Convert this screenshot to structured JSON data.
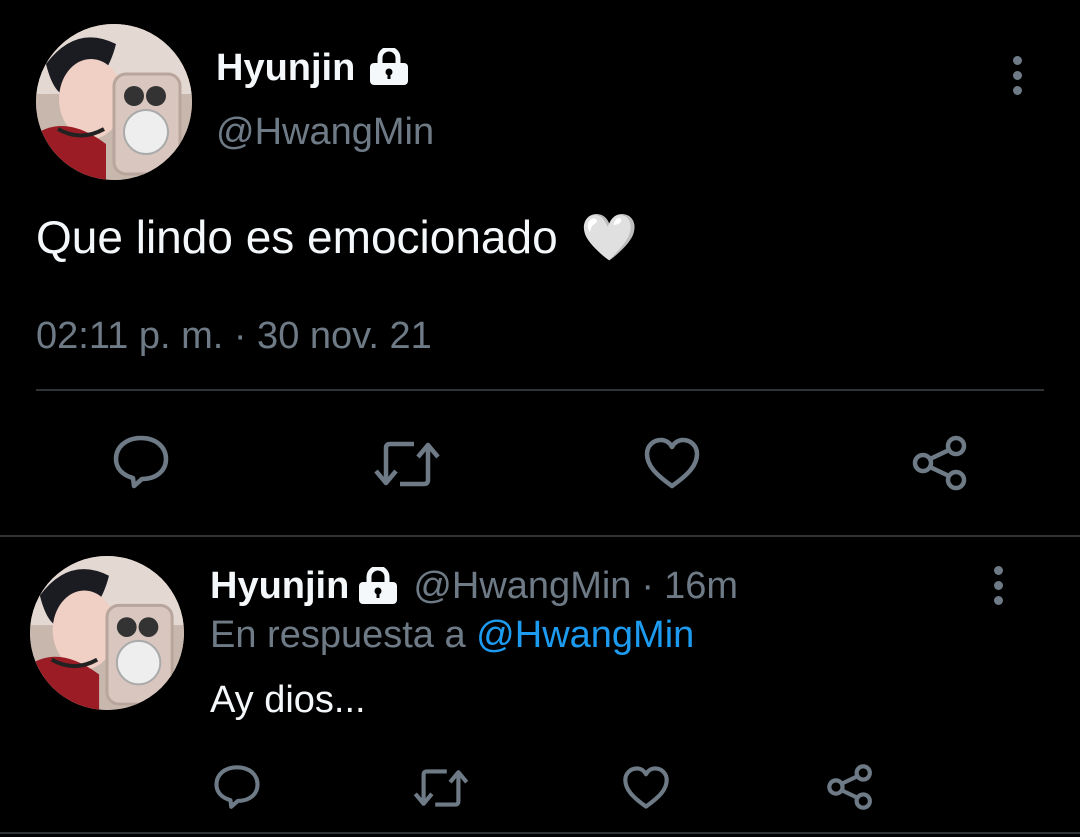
{
  "main_tweet": {
    "author_name": "Hyunjin",
    "author_handle": "@HwangMin",
    "text": "Que lindo es emocionado",
    "emoji": "🤍",
    "timestamp": "02:11 p. m. · 30 nov. 21",
    "icons": [
      "lock-icon",
      "more-options-icon",
      "reply-icon",
      "retweet-icon",
      "like-icon",
      "share-icon"
    ]
  },
  "reply_tweet": {
    "author_name": "Hyunjin",
    "author_handle": "@HwangMin",
    "separator": "·",
    "time_ago": "16m",
    "reply_prefix": "En respuesta a",
    "reply_to": "@HwangMin",
    "text": "Ay dios...",
    "icons": [
      "lock-icon",
      "more-options-icon",
      "reply-icon",
      "retweet-icon",
      "like-icon",
      "share-icon"
    ]
  },
  "colors": {
    "background": "#000000",
    "text": "#f5f8fa",
    "muted": "#6e7b87",
    "link": "#1d9bf0",
    "divider": "#2f3336"
  }
}
